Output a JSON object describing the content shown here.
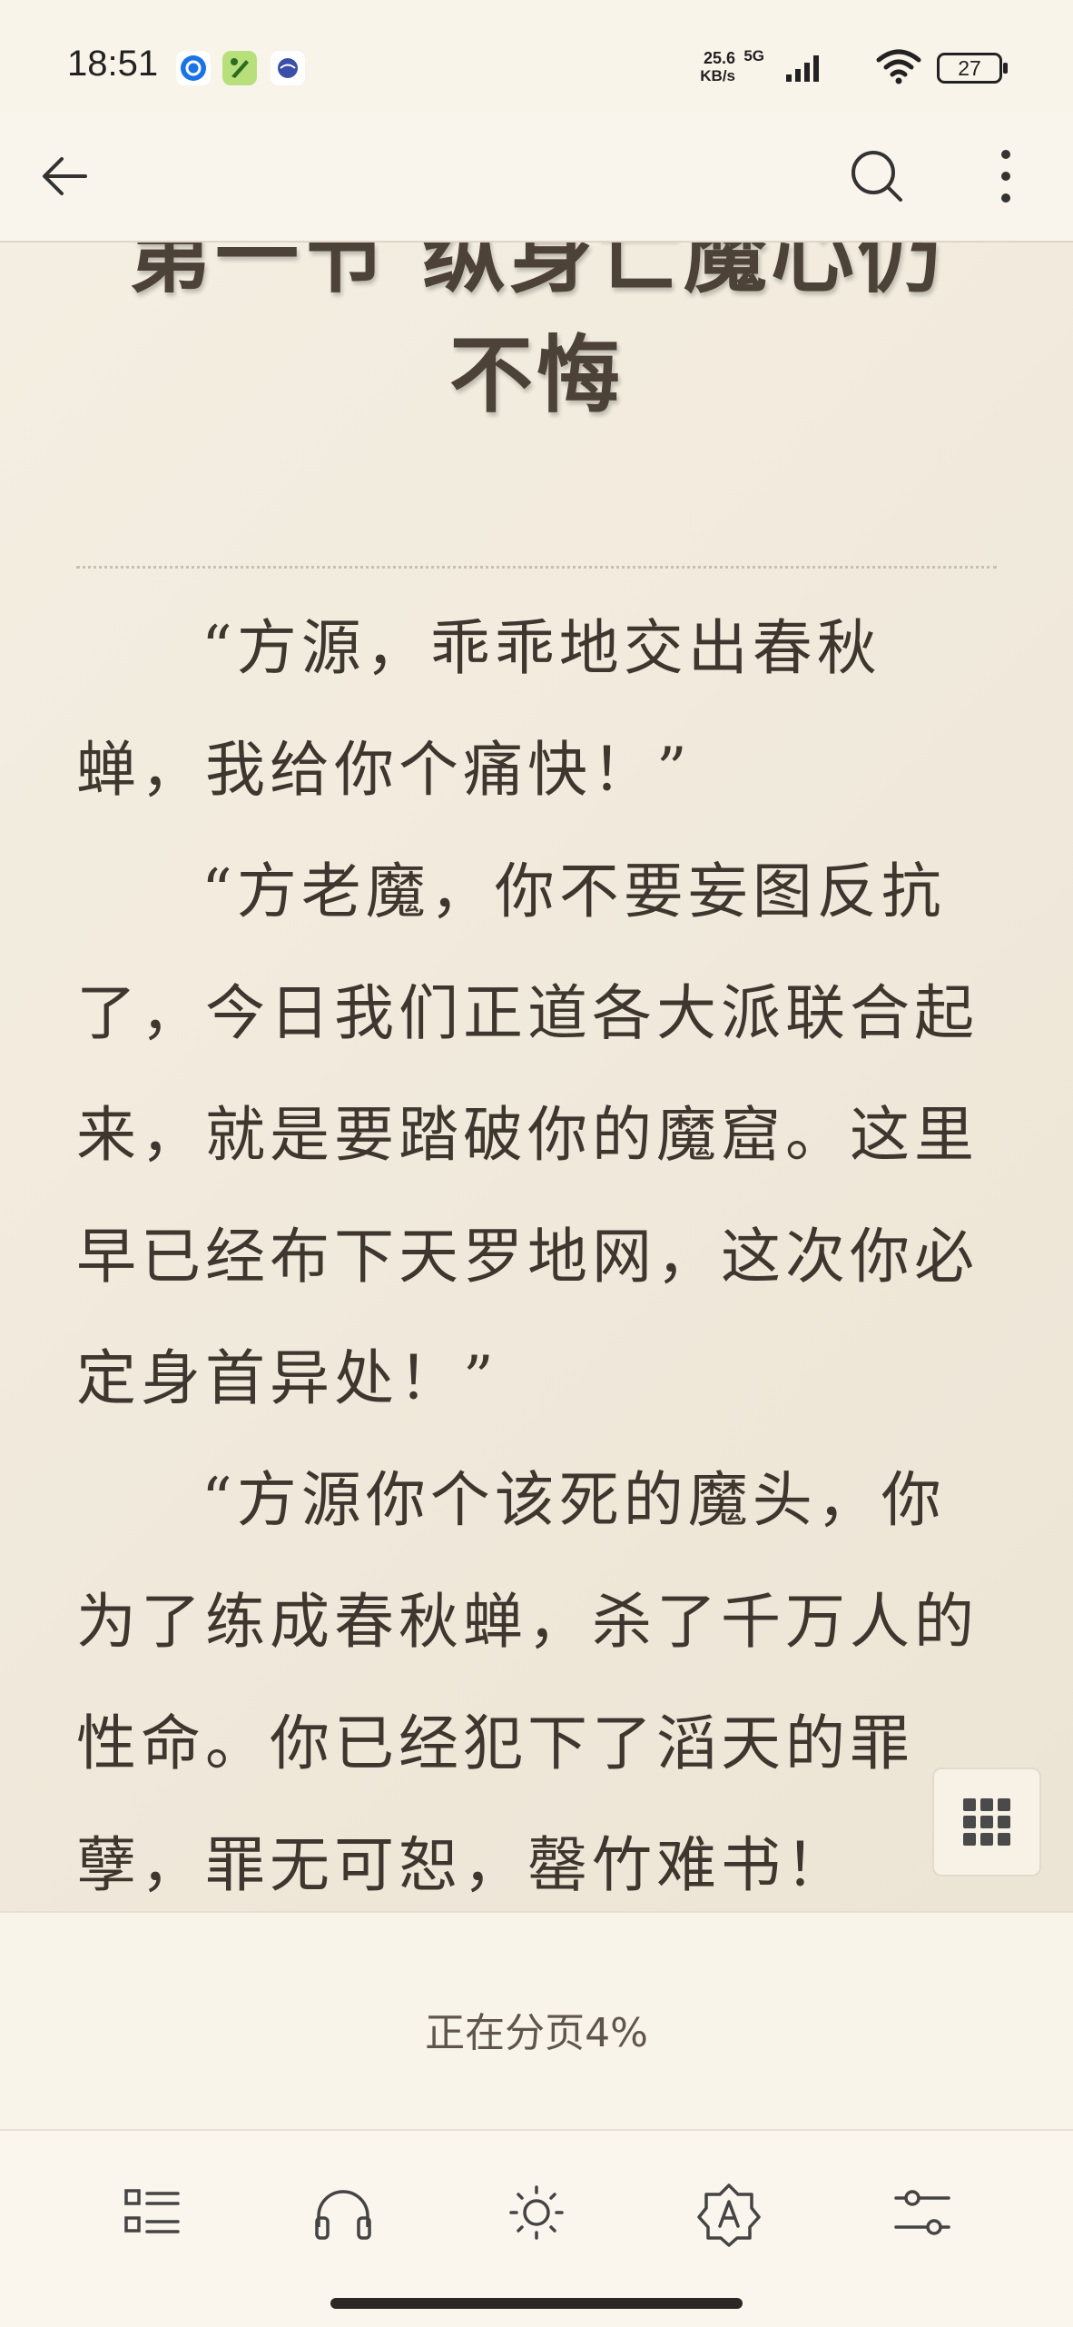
{
  "status_bar": {
    "time": "18:51",
    "app_icons": [
      "browser-app-icon",
      "cricket-app-icon",
      "app-icon"
    ],
    "net_speed_value": "25.6",
    "net_speed_unit": "KB/s",
    "network_type": "5G",
    "battery_level": "27",
    "signal_icon": "signal-icon",
    "wifi_icon": "wifi-icon"
  },
  "header": {
    "back_icon": "arrow-left-icon",
    "search_icon": "search-icon",
    "more_icon": "more-vertical-icon"
  },
  "chapter": {
    "title": "第一节 纵身亡魔心仍\n不悔",
    "paragraphs": [
      "“方源，乖乖地交出春秋蝉，我给你个痛快！”",
      "“方老魔，你不要妄图反抗了，今日我们正道各大派联合起来，就是要踏破你的魔窟。这里早已经布下天罗地网，这次你必定身首异处！”",
      "“方源你个该死的魔头，你为了练成春秋蝉，杀了千万人的性命。你已经犯下了滔天的罪孽，罪无可恕，罄竹难书！"
    ]
  },
  "grid_button_icon": "grid-icon",
  "pagination": {
    "text": "正在分页4%",
    "progress_percent": 4
  },
  "toolbar": {
    "items": [
      {
        "name": "catalog",
        "icon": "list-icon"
      },
      {
        "name": "listen",
        "icon": "headphones-icon"
      },
      {
        "name": "brightness",
        "icon": "sun-icon"
      },
      {
        "name": "auto-read",
        "icon": "auto-badge-icon"
      },
      {
        "name": "settings",
        "icon": "sliders-icon"
      }
    ]
  },
  "colors": {
    "page_background": "#f9f4ea",
    "reading_background": "#f0e9db",
    "text": "#3f372f"
  }
}
